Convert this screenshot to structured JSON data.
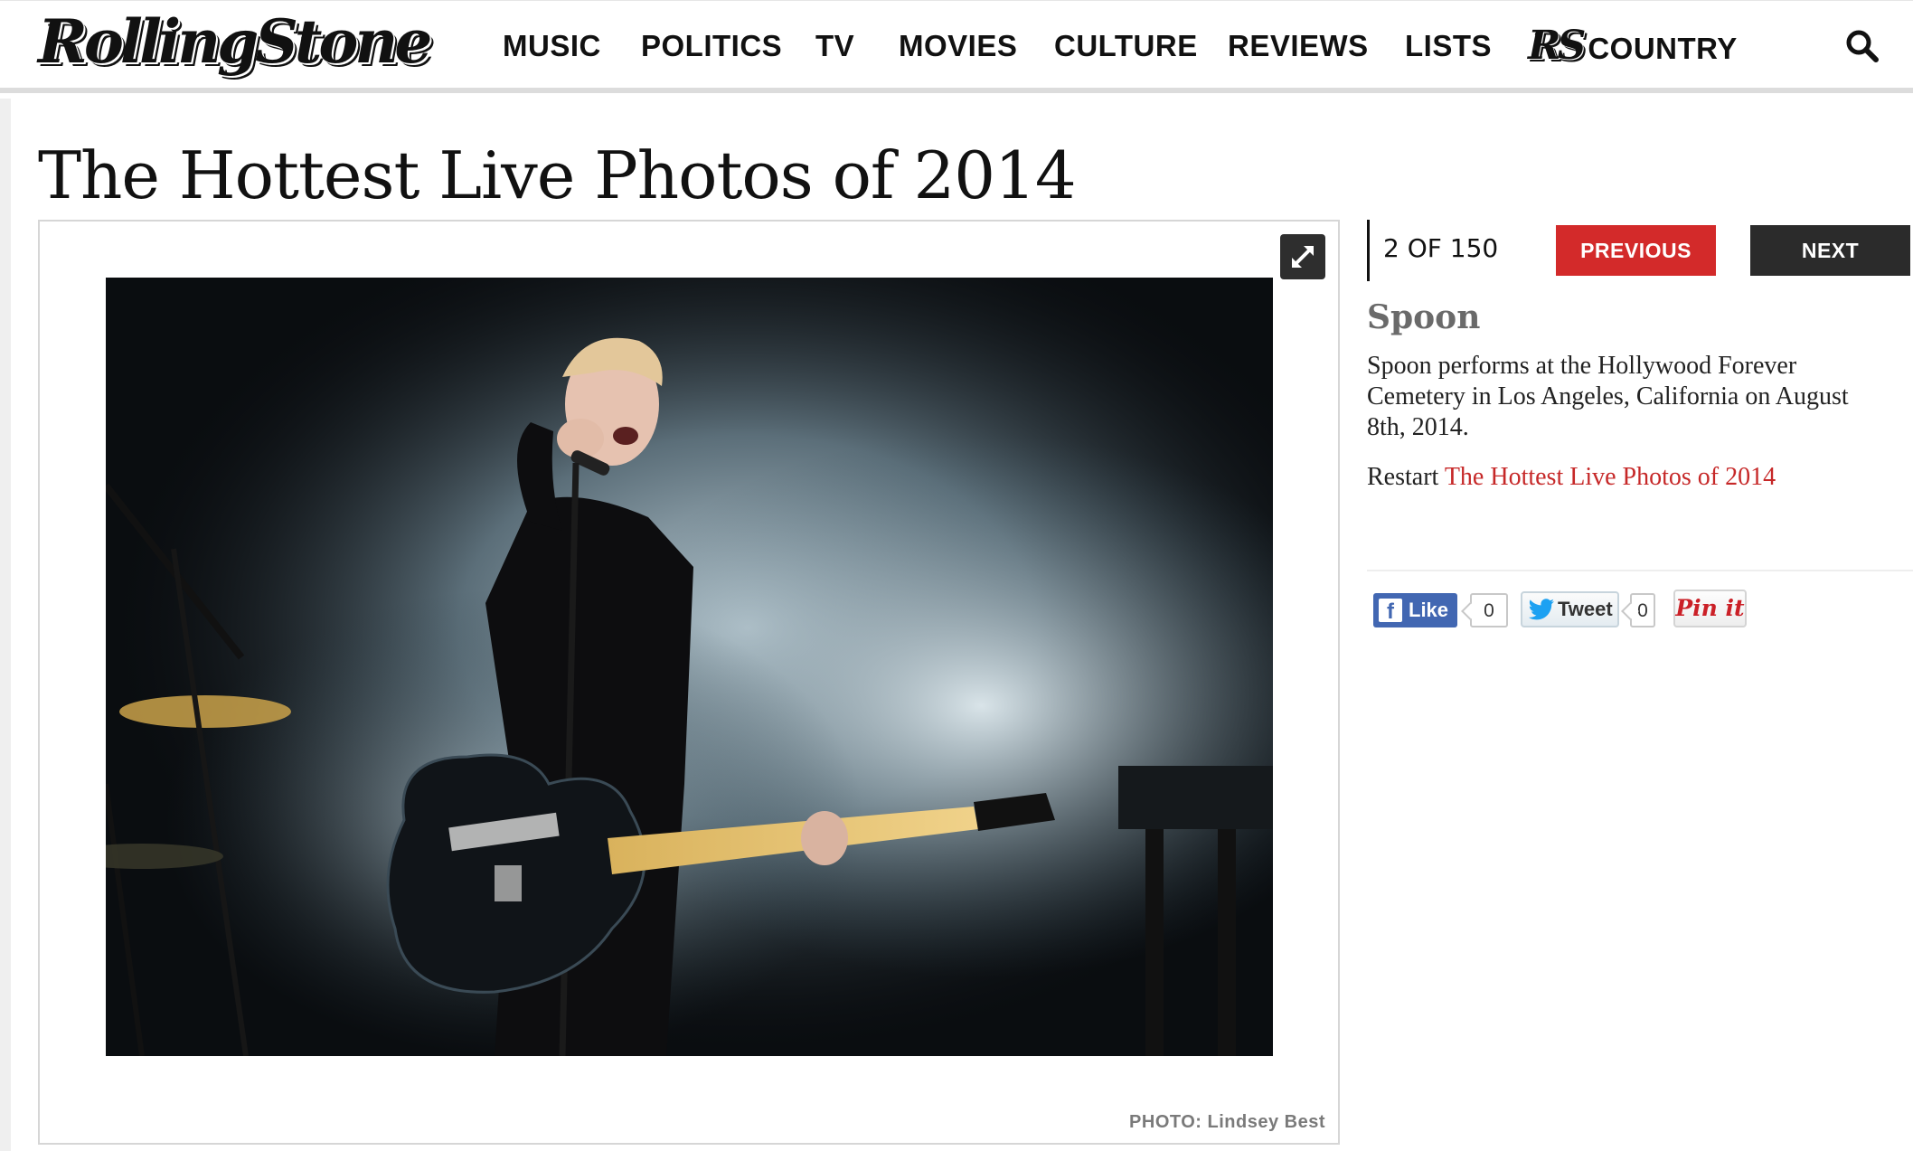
{
  "header": {
    "logo_text": "RollingStone",
    "nav": [
      {
        "label": "MUSIC"
      },
      {
        "label": "POLITICS"
      },
      {
        "label": "TV"
      },
      {
        "label": "MOVIES"
      },
      {
        "label": "CULTURE"
      },
      {
        "label": "REVIEWS"
      },
      {
        "label": "LISTS"
      },
      {
        "label": "COUNTRY",
        "prefix_logo": "RS"
      }
    ],
    "search_icon": "search-icon"
  },
  "gallery": {
    "title": "The Hottest Live Photos of 2014",
    "counter": "2 OF 150",
    "previous_label": "PREVIOUS",
    "next_label": "NEXT",
    "expand_icon": "expand-icon",
    "photo_credit": "PHOTO: Lindsey Best"
  },
  "slide": {
    "title": "Spoon",
    "caption": "Spoon performs at the Hollywood Forever Cemetery in Los Angeles, California on August 8th, 2014.",
    "restart_prefix": "Restart",
    "restart_link": "The Hottest Live Photos of 2014"
  },
  "social": {
    "fb_label": "Like",
    "fb_count": "0",
    "tweet_label": "Tweet",
    "tweet_count": "0",
    "pin_label": "Pin it"
  },
  "colors": {
    "accent_red": "#d32a2a",
    "link_red": "#c62828",
    "dark_button": "#2b2b2b",
    "facebook_blue": "#4267b2",
    "pinterest_red": "#cb2027"
  }
}
